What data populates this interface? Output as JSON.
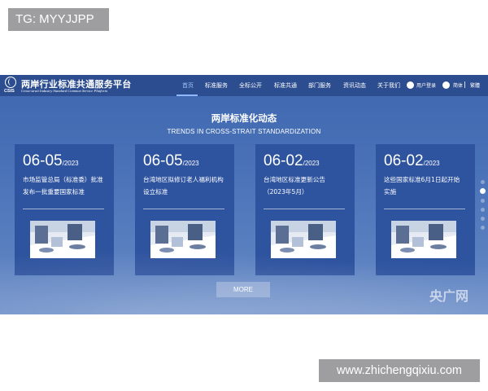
{
  "watermarks": {
    "top": "TG: MYYJJPP",
    "bottom": "www.zhichengqixiu.com"
  },
  "site": {
    "abbr": "CSIS",
    "name_cn": "两岸行业标准共通服务平台",
    "name_en": "Cross-strait Industry Standard Common Service Platform"
  },
  "nav": {
    "items": [
      {
        "label": "首页",
        "active": true
      },
      {
        "label": "标准服务"
      },
      {
        "label": "全标公开"
      },
      {
        "label": "标准共通"
      },
      {
        "label": "部门服务"
      },
      {
        "label": "资讯动态"
      },
      {
        "label": "关于我们"
      }
    ],
    "login": "用户登录",
    "lang_simplified": "简体",
    "lang_traditional": "繁體"
  },
  "section": {
    "title": "两岸标准化动态",
    "subtitle": "TRENDS IN CROSS-STRAIT STANDARDIZATION"
  },
  "news": [
    {
      "date": "06-05",
      "year": "/2023",
      "text": "市场监管总局（标准委）批准发布一批重要国家标准",
      "thumb_icon": "office-meeting-photo"
    },
    {
      "date": "06-05",
      "year": "/2023",
      "text": "台湾地区拟修订老人福利机构设立标准",
      "thumb_icon": "office-meeting-photo"
    },
    {
      "date": "06-02",
      "year": "/2023",
      "text": "台湾地区标准更新公告（2023年5月）",
      "thumb_icon": "office-meeting-photo"
    },
    {
      "date": "06-02",
      "year": "/2023",
      "text": "这些国家标准6月1日起开始实施",
      "thumb_icon": "office-meeting-photo"
    }
  ],
  "more_label": "MORE",
  "pager": {
    "active_index": 1,
    "count": 6
  },
  "broadcaster_logo": "央广网",
  "colors": {
    "header_bg": "#2c4d8f",
    "card_bg": "#2f549f",
    "page_bg": "#4a72b8",
    "nav_active": "#9fc3ff",
    "button_bg": "#8da6d3"
  }
}
